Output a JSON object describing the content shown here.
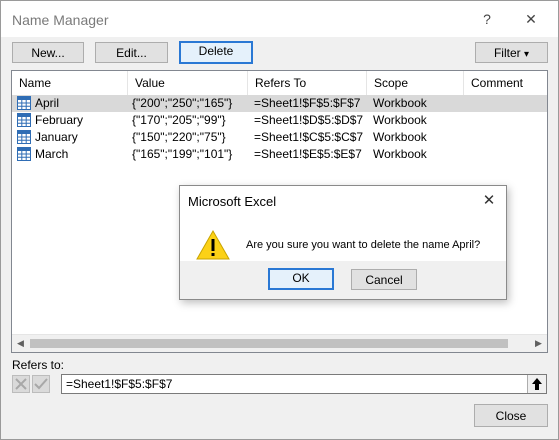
{
  "window": {
    "title": "Name Manager",
    "help_glyph": "?",
    "close_glyph": "✕"
  },
  "toolbar": {
    "new_label": "New...",
    "edit_label": "Edit...",
    "delete_label": "Delete",
    "filter_label": "Filter",
    "filter_arrow": "▾"
  },
  "table": {
    "headers": [
      "Name",
      "Value",
      "Refers To",
      "Scope",
      "Comment"
    ],
    "rows": [
      {
        "name": "April",
        "value": "{\"200\";\"250\";\"165\"}",
        "refers_to": "=Sheet1!$F$5:$F$7",
        "scope": "Workbook",
        "comment": ""
      },
      {
        "name": "February",
        "value": "{\"170\";\"205\";\"99\"}",
        "refers_to": "=Sheet1!$D$5:$D$7",
        "scope": "Workbook",
        "comment": ""
      },
      {
        "name": "January",
        "value": "{\"150\";\"220\";\"75\"}",
        "refers_to": "=Sheet1!$C$5:$C$7",
        "scope": "Workbook",
        "comment": ""
      },
      {
        "name": "March",
        "value": "{\"165\";\"199\";\"101\"}",
        "refers_to": "=Sheet1!$E$5:$E$7",
        "scope": "Workbook",
        "comment": ""
      }
    ],
    "selected_row": 0
  },
  "refers_to": {
    "label": "Refers to:",
    "value": "=Sheet1!$F$5:$F$7"
  },
  "footer": {
    "close_label": "Close"
  },
  "dialog": {
    "title": "Microsoft Excel",
    "close_glyph": "✕",
    "message": "Are you sure you want to delete the name April?",
    "ok_label": "OK",
    "cancel_label": "Cancel",
    "icon": "warning-icon"
  },
  "colors": {
    "accent": "#2a78d4",
    "warning": "#fcd116",
    "grid_icon": "#2f6db5"
  }
}
